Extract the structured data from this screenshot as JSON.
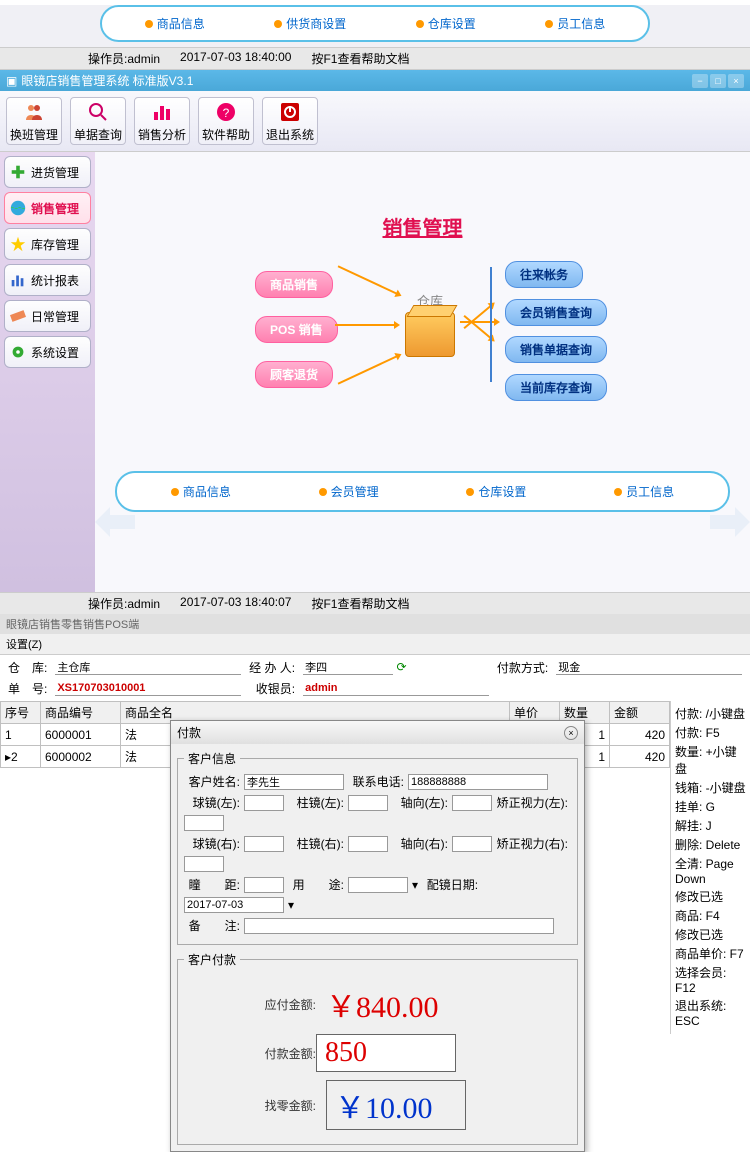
{
  "top_buttons": [
    "商品信息",
    "供货商设置",
    "仓库设置",
    "员工信息"
  ],
  "status1": {
    "operator_label": "操作员:",
    "operator": "admin",
    "time": "2017-07-03 18:40:00",
    "help": "按F1查看帮助文档"
  },
  "window_title": "眼镜店销售管理系统 标准版V3.1",
  "toolbar": [
    {
      "label": "换班管理"
    },
    {
      "label": "单据查询"
    },
    {
      "label": "销售分析"
    },
    {
      "label": "软件帮助"
    },
    {
      "label": "退出系统"
    }
  ],
  "sidebar": [
    {
      "label": "进货管理"
    },
    {
      "label": "销售管理"
    },
    {
      "label": "库存管理"
    },
    {
      "label": "统计报表"
    },
    {
      "label": "日常管理"
    },
    {
      "label": "系统设置"
    }
  ],
  "content_title": "销售管理",
  "warehouse_label": "仓库",
  "left_pills": [
    "商品销售",
    "POS 销售",
    "顾客退货"
  ],
  "right_pills": [
    "往来帐务",
    "会员销售查询",
    "销售单据查询",
    "当前库存查询"
  ],
  "bottom_buttons": [
    "商品信息",
    "会员管理",
    "仓库设置",
    "员工信息"
  ],
  "status2": {
    "operator_label": "操作员:",
    "operator": "admin",
    "time": "2017-07-03 18:40:07",
    "help": "按F1查看帮助文档"
  },
  "pos_title": "眼镜店销售零售销售POS端",
  "menu_label": "设置(Z)",
  "pos_form": {
    "warehouse_lbl": "仓　库:",
    "warehouse": "主仓库",
    "handler_lbl": "经 办 人:",
    "handler": "李四",
    "paytype_lbl": "付款方式:",
    "paytype": "现金",
    "orderno_lbl": "单　号:",
    "orderno": "XS170703010001",
    "cashier_lbl": "收银员:",
    "cashier": "admin"
  },
  "table": {
    "headers": [
      "序号",
      "商品编号",
      "商品全名",
      "单价",
      "数量",
      "金额"
    ],
    "rows": [
      {
        "seq": "1",
        "code": "6000001",
        "name": "法",
        "qty": "1",
        "amount": "420"
      },
      {
        "seq": "2",
        "code": "6000002",
        "name": "法",
        "qty": "1",
        "amount": "420"
      }
    ]
  },
  "shortcuts": [
    "付款: /小键盘",
    "付款: F5",
    "数量: +小键盘",
    "钱箱: -小键盘",
    "挂单: G",
    "解挂: J",
    "删除: Delete",
    "全清: Page Down",
    "修改已选",
    "商品: F4",
    "修改已选",
    "商品单价: F7",
    "选择会员: F12",
    "退出系统: ESC"
  ],
  "dialog": {
    "title": "付款",
    "section1": "客户信息",
    "name_lbl": "客户姓名:",
    "name": "李先生",
    "phone_lbl": "联系电话:",
    "phone": "188888888",
    "sphL_lbl": "球镜(左):",
    "cylL_lbl": "柱镜(左):",
    "axisL_lbl": "轴向(左):",
    "visionL_lbl": "矫正视力(左):",
    "sphR_lbl": "球镜(右):",
    "cylR_lbl": "柱镜(右):",
    "axisR_lbl": "轴向(右):",
    "visionR_lbl": "矫正视力(右):",
    "pd_lbl": "瞳　　距:",
    "use_lbl": "用　　途:",
    "date_lbl": "配镜日期:",
    "date": "2017-07-03",
    "note_lbl": "备　　注:",
    "section2": "客户付款",
    "due_lbl": "应付金额:",
    "due": "￥840.00",
    "paid_lbl": "付款金额:",
    "paid": "850",
    "change_lbl": "找零金额:",
    "change": "￥10.00"
  }
}
